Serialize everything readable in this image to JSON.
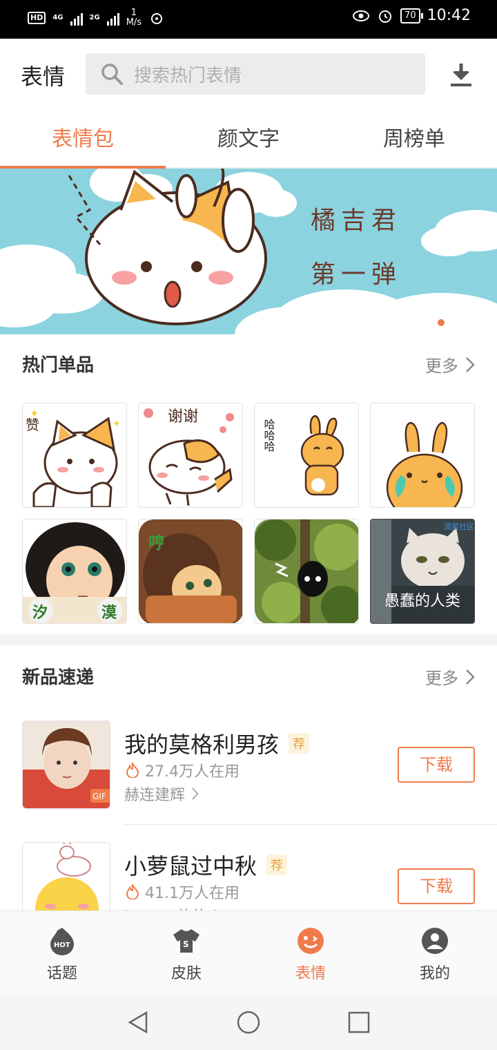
{
  "status_bar": {
    "left": {
      "hd": "HD",
      "net1": "4G",
      "net2": "2G",
      "speed_value": "1",
      "speed_unit": "M/s"
    },
    "right": {
      "battery": "70",
      "time": "10:42"
    }
  },
  "header": {
    "title": "表情",
    "search_placeholder": "搜索热门表情"
  },
  "tabs": [
    {
      "label": "表情包",
      "active": true
    },
    {
      "label": "颜文字",
      "active": false
    },
    {
      "label": "周榜单",
      "active": false
    }
  ],
  "banner": {
    "line1": "橘吉君",
    "line2": "第一弹",
    "pages": 3,
    "active_page": 1
  },
  "hot": {
    "title": "热门单品",
    "more": "更多",
    "items": [
      {
        "name": "cat-thumbs-up",
        "caption": "赞"
      },
      {
        "name": "cat-thank-you",
        "caption": "谢谢"
      },
      {
        "name": "rabbit-laugh",
        "caption": "哈哈哈"
      },
      {
        "name": "rabbit-cry",
        "caption": ""
      },
      {
        "name": "girl-dumbfounded",
        "caption": ""
      },
      {
        "name": "girl-hug",
        "caption": "哼"
      },
      {
        "name": "black-cat-forest",
        "caption": ""
      },
      {
        "name": "grumpy-cat",
        "caption": "愚蠢的人类",
        "watermark": "流星社区"
      }
    ]
  },
  "new": {
    "title": "新品速递",
    "more": "更多",
    "items": [
      {
        "name": "我的莫格利男孩",
        "tag": "荐",
        "users": "27.4万人在用",
        "author": "赫连建辉",
        "button": "下载",
        "thumb_label": "GIF"
      },
      {
        "name": "小萝鼠过中秋",
        "tag": "荐",
        "users": "41.1万人在用",
        "author": "Jammy佳佳",
        "button": "下载"
      }
    ]
  },
  "bottom_nav": [
    {
      "label": "话题",
      "icon": "hot-icon",
      "active": false
    },
    {
      "label": "皮肤",
      "icon": "shirt-icon",
      "active": false
    },
    {
      "label": "表情",
      "icon": "smile-icon",
      "active": true
    },
    {
      "label": "我的",
      "icon": "user-icon",
      "active": false
    }
  ],
  "colors": {
    "accent": "#ef7b4b",
    "sky": "#8cd3e0"
  }
}
